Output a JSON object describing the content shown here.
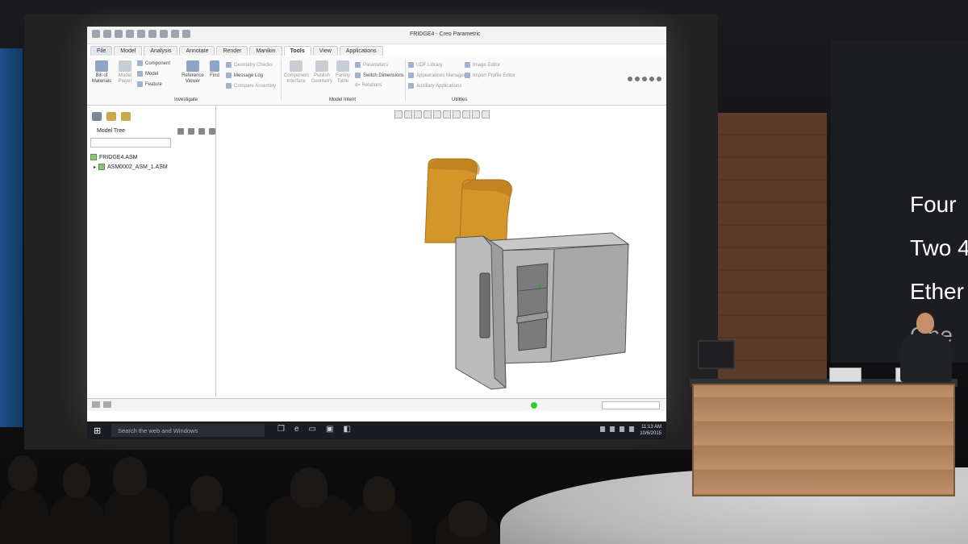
{
  "window": {
    "title": "FRIDGE4 - Creo Parametric"
  },
  "ribbon": {
    "tabs": [
      "File",
      "Model",
      "Analysis",
      "Annotate",
      "Render",
      "Manikin",
      "Tools",
      "View",
      "Applications"
    ],
    "active_tab": "Tools",
    "investigate": {
      "bill_of_materials": "Bill of Materials",
      "model_player": "Model Player",
      "component": "Component",
      "model": "Model",
      "feature": "Feature",
      "reference_viewer": "Reference Viewer",
      "find": "Find",
      "geometry_checks": "Geometry Checks",
      "message_log": "Message Log",
      "compare_assembly": "Compare Assembly",
      "group_label": "Investigate"
    },
    "model_intent": {
      "component_interface": "Component Interface",
      "publish_geometry": "Publish Geometry",
      "family_table": "Family Table",
      "parameters": "Parameters",
      "switch_dimensions": "Switch Dimensions",
      "relations": "d= Relations",
      "group_label": "Model Intent"
    },
    "utilities": {
      "udf_library": "UDF Library",
      "appearances_manager": "Appearances Manager",
      "auxiliary_applications": "Auxiliary Applications",
      "image_editor": "Image Editor",
      "import_profile_editor": "Import Profile Editor",
      "group_label": "Utilities"
    }
  },
  "model_tree": {
    "label": "Model Tree",
    "items": [
      "FRIDGE4.ASM",
      "ASM0002_ASM_1.ASM"
    ]
  },
  "taskbar": {
    "search_placeholder": "Search the web and Windows",
    "time": "11:13 AM",
    "date": "10/6/2015"
  },
  "slide": {
    "lines": [
      "Four",
      "Two 4",
      "Ether",
      "One"
    ]
  },
  "colors": {
    "toast": "#D4952A",
    "fridge": "#A8A8A8",
    "wood": "#B38660"
  }
}
